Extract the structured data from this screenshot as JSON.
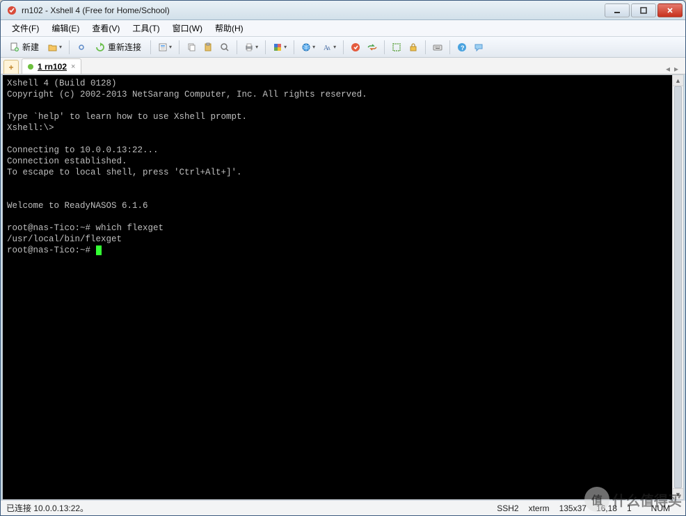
{
  "window": {
    "title": "rn102 - Xshell 4 (Free for Home/School)"
  },
  "menu": {
    "items": [
      "文件(F)",
      "编辑(E)",
      "查看(V)",
      "工具(T)",
      "窗口(W)",
      "帮助(H)"
    ]
  },
  "toolbar": {
    "new_label": "新建",
    "reconnect_label": "重新连接"
  },
  "tabs": {
    "items": [
      {
        "label": "1 rn102",
        "active": true
      }
    ]
  },
  "terminal": {
    "lines": [
      "Xshell 4 (Build 0128)",
      "Copyright (c) 2002-2013 NetSarang Computer, Inc. All rights reserved.",
      "",
      "Type `help' to learn how to use Xshell prompt.",
      "Xshell:\\>",
      "",
      "Connecting to 10.0.0.13:22...",
      "Connection established.",
      "To escape to local shell, press 'Ctrl+Alt+]'.",
      "",
      "",
      "Welcome to ReadyNASOS 6.1.6",
      "",
      "root@nas-Tico:~# which flexget",
      "/usr/local/bin/flexget",
      "root@nas-Tico:~# "
    ]
  },
  "status": {
    "connection": "已连接 10.0.0.13:22。",
    "protocol": "SSH2",
    "term_type": "xterm",
    "dimensions": "135x37",
    "cursor": "16,18",
    "sessions": "1",
    "caps": " ",
    "num": "NUM"
  },
  "watermark": {
    "logo_text": "值",
    "text": "什么值得买"
  }
}
